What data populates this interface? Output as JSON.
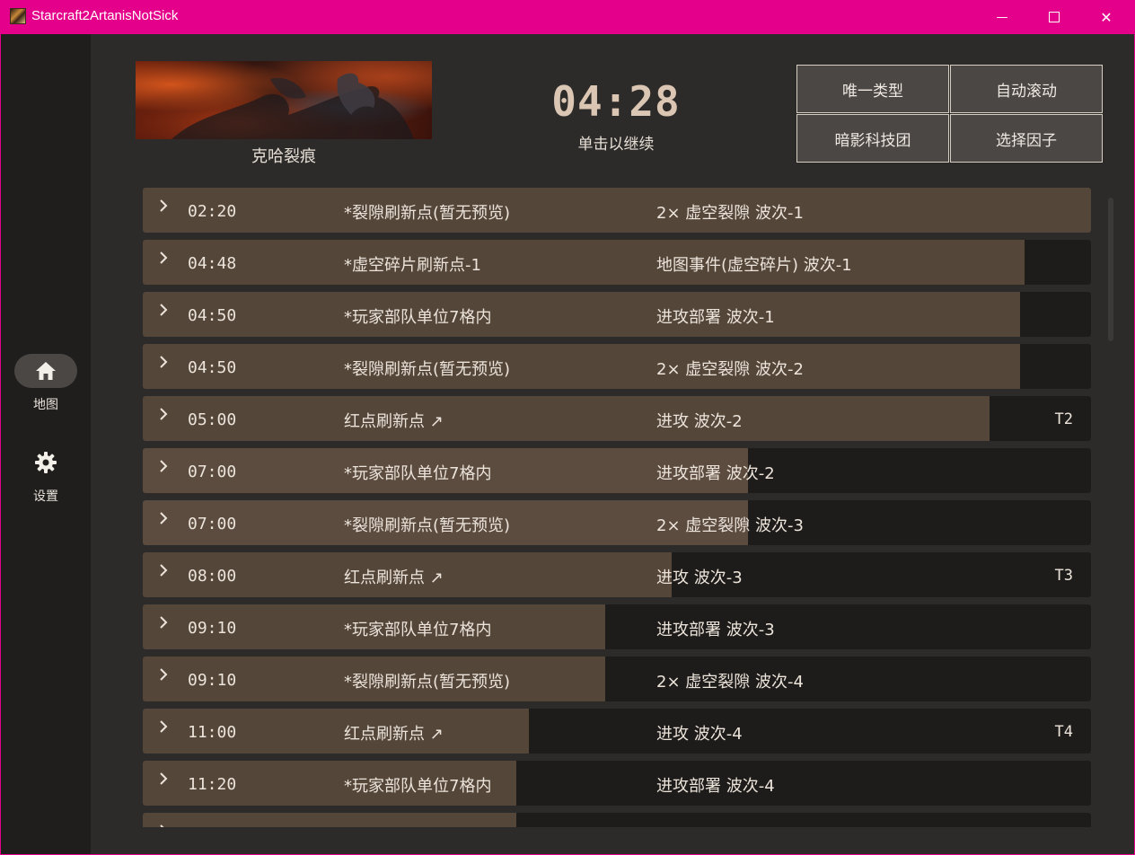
{
  "window": {
    "title": "Starcraft2ArtanisNotSick",
    "minimize": "—",
    "close": "✕"
  },
  "sidebar": {
    "items": [
      {
        "label": "地图",
        "icon": "home-icon",
        "active": true
      },
      {
        "label": "设置",
        "icon": "gear-icon",
        "active": false
      }
    ]
  },
  "header": {
    "map_name": "克哈裂痕",
    "timer": "04:28",
    "timer_hint": "单击以继续",
    "buttons": [
      "唯一类型",
      "自动滚动",
      "暗影科技团",
      "选择因子"
    ]
  },
  "events": [
    {
      "time": "02:20",
      "desc": "*裂隙刷新点(暂无预览)",
      "event": "2× 虚空裂隙 波次-1",
      "tier": "",
      "progress": 1.0
    },
    {
      "time": "04:48",
      "desc": "*虚空碎片刷新点-1",
      "event": "地图事件(虚空碎片) 波次-1",
      "tier": "",
      "progress": 0.93
    },
    {
      "time": "04:50",
      "desc": "*玩家部队单位7格内",
      "event": "进攻部署 波次-1",
      "tier": "",
      "progress": 0.925
    },
    {
      "time": "04:50",
      "desc": "*裂隙刷新点(暂无预览)",
      "event": "2× 虚空裂隙 波次-2",
      "tier": "",
      "progress": 0.925
    },
    {
      "time": "05:00",
      "desc": "红点刷新点 ↗",
      "event": "进攻 波次-2",
      "tier": "T2",
      "progress": 0.893
    },
    {
      "time": "07:00",
      "desc": "*玩家部队单位7格内",
      "event": "进攻部署 波次-2",
      "tier": "",
      "progress": 0.638
    },
    {
      "time": "07:00",
      "desc": "*裂隙刷新点(暂无预览)",
      "event": "2× 虚空裂隙 波次-3",
      "tier": "",
      "progress": 0.638
    },
    {
      "time": "08:00",
      "desc": "红点刷新点 ↗",
      "event": "进攻 波次-3",
      "tier": "T3",
      "progress": 0.558
    },
    {
      "time": "09:10",
      "desc": "*玩家部队单位7格内",
      "event": "进攻部署 波次-3",
      "tier": "",
      "progress": 0.488
    },
    {
      "time": "09:10",
      "desc": "*裂隙刷新点(暂无预览)",
      "event": "2× 虚空裂隙 波次-4",
      "tier": "",
      "progress": 0.488
    },
    {
      "time": "11:00",
      "desc": "红点刷新点 ↗",
      "event": "进攻 波次-4",
      "tier": "T4",
      "progress": 0.407
    },
    {
      "time": "11:20",
      "desc": "*玩家部队单位7格内",
      "event": "进攻部署 波次-4",
      "tier": "",
      "progress": 0.394
    },
    {
      "time": "",
      "desc": "",
      "event": "",
      "tier": "",
      "progress": 0.394
    }
  ],
  "colors": {
    "titlebar": "#e5008c",
    "fill": "#55463a",
    "row_bg": "#1e1c1b",
    "timer": "#dbc6b4"
  }
}
